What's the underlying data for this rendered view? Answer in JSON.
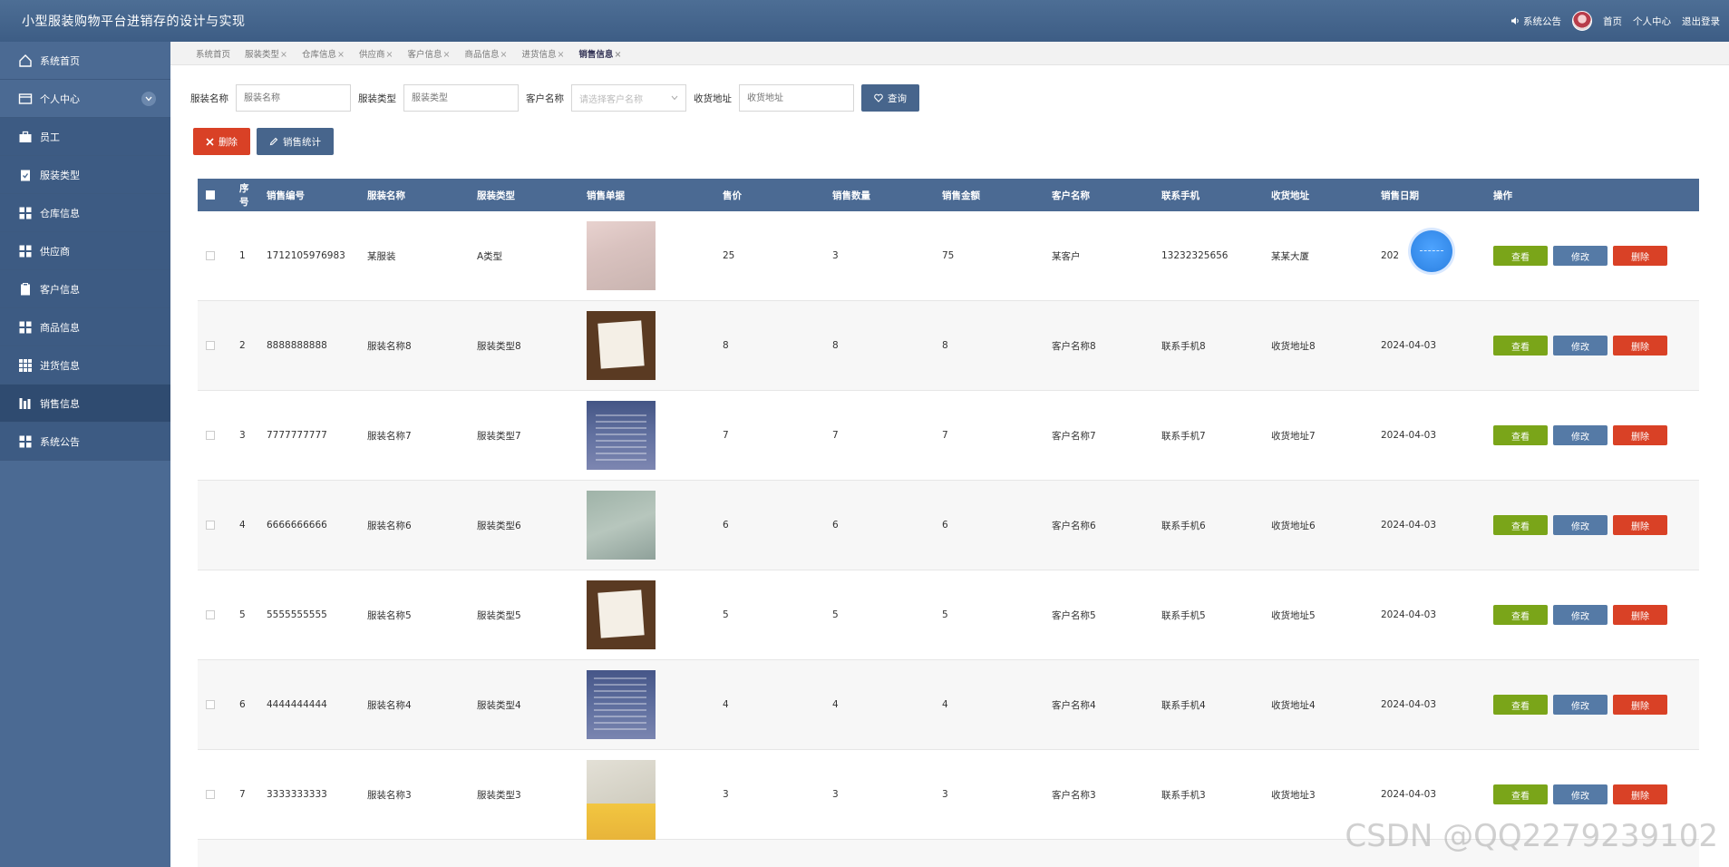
{
  "header": {
    "title": "小型服装购物平台进销存的设计与实现",
    "links": [
      "系统公告",
      "首页",
      "个人中心",
      "退出登录"
    ]
  },
  "sidebar": {
    "items": [
      {
        "label": "系统首页",
        "icon": "home-icon"
      },
      {
        "label": "个人中心",
        "icon": "card-icon"
      },
      {
        "label": "员工",
        "icon": "briefcase-icon"
      },
      {
        "label": "服装类型",
        "icon": "clipboard-check-icon"
      },
      {
        "label": "仓库信息",
        "icon": "grid-icon"
      },
      {
        "label": "供应商",
        "icon": "grid-icon"
      },
      {
        "label": "客户信息",
        "icon": "clipboard-icon"
      },
      {
        "label": "商品信息",
        "icon": "grid-icon"
      },
      {
        "label": "进货信息",
        "icon": "grid-icon"
      },
      {
        "label": "销售信息",
        "icon": "bars-icon"
      },
      {
        "label": "系统公告",
        "icon": "grid-icon"
      }
    ]
  },
  "tabs": [
    {
      "label": "系统首页",
      "close": ""
    },
    {
      "label": "服装类型",
      "close": "×"
    },
    {
      "label": "仓库信息",
      "close": "×"
    },
    {
      "label": "供应商",
      "close": "×"
    },
    {
      "label": "客户信息",
      "close": "×"
    },
    {
      "label": "商品信息",
      "close": "×"
    },
    {
      "label": "进货信息",
      "close": "×"
    },
    {
      "label": "销售信息",
      "close": "×"
    }
  ],
  "search": {
    "name_label": "服装名称",
    "name_placeholder": "服装名称",
    "type_label": "服装类型",
    "type_placeholder": "服装类型",
    "customer_label": "客户名称",
    "customer_placeholder": "请选择客户名称",
    "address_label": "收货地址",
    "address_placeholder": "收货地址",
    "query_button": "查询"
  },
  "actions": {
    "delete": "删除",
    "stats": "销售统计"
  },
  "table": {
    "headers": [
      "序号",
      "销售编号",
      "服装名称",
      "服装类型",
      "销售单据",
      "售价",
      "销售数量",
      "销售金额",
      "客户名称",
      "联系手机",
      "收货地址",
      "销售日期",
      "操作"
    ],
    "rows": [
      {
        "idx": "1",
        "code": "1712105976983",
        "name": "某服装",
        "type": "A类型",
        "price": "25",
        "qty": "3",
        "amount": "75",
        "customer": "某客户",
        "phone": "13232325656",
        "address": "某某大厦",
        "date": "202"
      },
      {
        "idx": "2",
        "code": "8888888888",
        "name": "服装名称8",
        "type": "服装类型8",
        "price": "8",
        "qty": "8",
        "amount": "8",
        "customer": "客户名称8",
        "phone": "联系手机8",
        "address": "收货地址8",
        "date": "2024-04-03"
      },
      {
        "idx": "3",
        "code": "7777777777",
        "name": "服装名称7",
        "type": "服装类型7",
        "price": "7",
        "qty": "7",
        "amount": "7",
        "customer": "客户名称7",
        "phone": "联系手机7",
        "address": "收货地址7",
        "date": "2024-04-03"
      },
      {
        "idx": "4",
        "code": "6666666666",
        "name": "服装名称6",
        "type": "服装类型6",
        "price": "6",
        "qty": "6",
        "amount": "6",
        "customer": "客户名称6",
        "phone": "联系手机6",
        "address": "收货地址6",
        "date": "2024-04-03"
      },
      {
        "idx": "5",
        "code": "5555555555",
        "name": "服装名称5",
        "type": "服装类型5",
        "price": "5",
        "qty": "5",
        "amount": "5",
        "customer": "客户名称5",
        "phone": "联系手机5",
        "address": "收货地址5",
        "date": "2024-04-03"
      },
      {
        "idx": "6",
        "code": "4444444444",
        "name": "服装名称4",
        "type": "服装类型4",
        "price": "4",
        "qty": "4",
        "amount": "4",
        "customer": "客户名称4",
        "phone": "联系手机4",
        "address": "收货地址4",
        "date": "2024-04-03"
      },
      {
        "idx": "7",
        "code": "3333333333",
        "name": "服装名称3",
        "type": "服装类型3",
        "price": "3",
        "qty": "3",
        "amount": "3",
        "customer": "客户名称3",
        "phone": "联系手机3",
        "address": "收货地址3",
        "date": "2024-04-03"
      }
    ],
    "ops": {
      "view": "查看",
      "edit": "修改",
      "delete": "删除"
    }
  },
  "watermark": "CSDN @QQ2279239102",
  "colors": {
    "header": "#4b6a93",
    "sidebar": "#4b6a93",
    "view": "#7aa519",
    "edit": "#557aa6",
    "delete": "#d94126"
  }
}
